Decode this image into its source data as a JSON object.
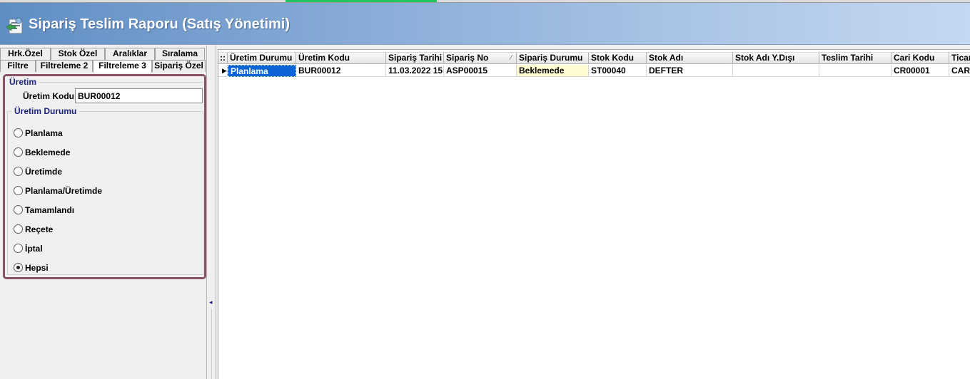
{
  "window": {
    "title": "Sipariş Teslim Raporu (Satış Yönetimi)"
  },
  "tabs": {
    "row1": [
      {
        "label": "Hrk.Özel"
      },
      {
        "label": "Stok Özel"
      },
      {
        "label": "Aralıklar"
      },
      {
        "label": "Sıralama"
      }
    ],
    "row2": [
      {
        "label": "Filtre"
      },
      {
        "label": "Filtreleme 2"
      },
      {
        "label": "Filtreleme 3"
      },
      {
        "label": "Sipariş Özel"
      }
    ],
    "active": "Filtreleme 3"
  },
  "filter": {
    "uretim_group_title": "Üretim",
    "uretim_kodu_label": "Üretim Kodu",
    "uretim_kodu_value": "BUR00012",
    "durum_group_title": "Üretim Durumu",
    "options": [
      {
        "label": "Planlama",
        "checked": false
      },
      {
        "label": "Beklemede",
        "checked": false
      },
      {
        "label": "Üretimde",
        "checked": false
      },
      {
        "label": "Planlama/Üretimde",
        "checked": false
      },
      {
        "label": "Tamamlandı",
        "checked": false
      },
      {
        "label": "Reçete",
        "checked": false
      },
      {
        "label": "İptal",
        "checked": false
      },
      {
        "label": "Hepsi",
        "checked": true
      }
    ]
  },
  "grid": {
    "indicator_header": "::",
    "headers": [
      "Üretim Durumu",
      "Üretim Kodu",
      "Sipariş Tarihi",
      "Sipariş No",
      "Sipariş Durumu",
      "Stok Kodu",
      "Stok Adı",
      "Stok Adı Y.Dışı",
      "Teslim Tarihi",
      "Cari Kodu",
      "Ticari"
    ],
    "sort_indicator": "⁄",
    "rows": [
      {
        "indicator": "▶",
        "cells": [
          "Planlama",
          "BUR00012",
          "11.03.2022 15",
          "ASP00015",
          "Beklemede",
          "ST00040",
          "DEFTER",
          "",
          "",
          "CR00001",
          "CARİ"
        ]
      }
    ]
  },
  "splitter": {
    "arrow": "◂"
  },
  "colors": {
    "title_gradient_start": "#5f8ec4",
    "title_gradient_end": "#c5d8f1",
    "filter_border": "#8a5266",
    "group_title": "#1a237e",
    "selected_cell": "#0a64d6",
    "pending_cell": "#fffbd0"
  }
}
